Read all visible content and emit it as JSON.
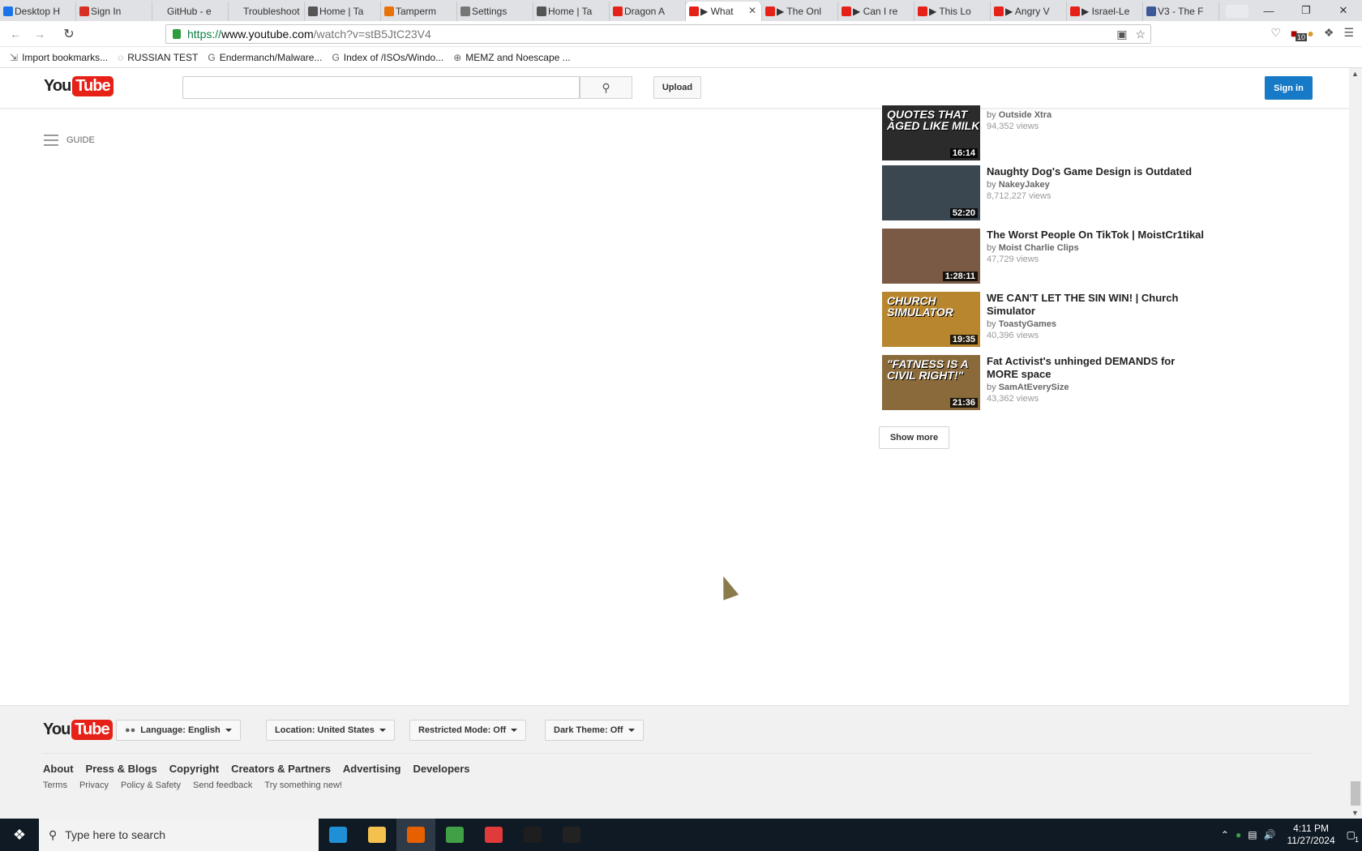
{
  "browser": {
    "tabs": [
      {
        "label": "Desktop H",
        "color": "#1a73e8"
      },
      {
        "label": "Sign In",
        "color": "#d93025"
      },
      {
        "label": "GitHub - e",
        "color": "#dfe1e5"
      },
      {
        "label": "Troubleshoot",
        "color": "#dfe1e5"
      },
      {
        "label": "Home | Ta",
        "color": "#555555"
      },
      {
        "label": "Tamperm",
        "color": "#e8710a"
      },
      {
        "label": "Settings",
        "color": "#777777"
      },
      {
        "label": "Home | Ta",
        "color": "#555555"
      },
      {
        "label": "Dragon A",
        "color": "#e62117"
      },
      {
        "label": "▶ What",
        "color": "#e62117",
        "active": true
      },
      {
        "label": "▶ The Onl",
        "color": "#e62117"
      },
      {
        "label": "▶ Can I re",
        "color": "#e62117"
      },
      {
        "label": "▶ This Lo",
        "color": "#e62117"
      },
      {
        "label": "▶ Angry V",
        "color": "#e62117"
      },
      {
        "label": "▶ Israel-Le",
        "color": "#e62117"
      },
      {
        "label": "V3 - The F",
        "color": "#3b5998"
      }
    ],
    "window_controls": {
      "minimize": "—",
      "maximize": "❐",
      "close": "✕"
    },
    "url": {
      "scheme": "https://",
      "host": "www.youtube.com",
      "path": "/watch?v=stB5JtC23V4"
    },
    "extension_badge": "10",
    "bookmarks": [
      {
        "label": "Import bookmarks...",
        "icon": "import-icon"
      },
      {
        "label": "RUSSIAN TEST",
        "icon": "blank-page-icon"
      },
      {
        "label": "Endermanch/Malware...",
        "icon": "google-icon"
      },
      {
        "label": "Index of /ISOs/Windo...",
        "icon": "google-icon"
      },
      {
        "label": "MEMZ and Noescape ...",
        "icon": "globe-icon"
      }
    ]
  },
  "youtube": {
    "logo": {
      "you": "You",
      "tube": "Tube"
    },
    "search_placeholder": "",
    "upload_label": "Upload",
    "signin_label": "Sign in",
    "guide_label": "GUIDE",
    "related": [
      {
        "title": "",
        "channel": "Outside Xtra",
        "views": "94,352 views",
        "duration": "16:14",
        "thumb_text": "QUOTES THAT AGED LIKE MILK",
        "thumb_color": "#2b2b2b"
      },
      {
        "title": "Naughty Dog's Game Design is Outdated",
        "channel": "NakeyJakey",
        "views": "8,712,227 views",
        "duration": "52:20",
        "thumb_text": "",
        "thumb_color": "#3a4650"
      },
      {
        "title": "The Worst People On TikTok | MoistCr1tikal",
        "channel": "Moist Charlie Clips",
        "views": "47,729 views",
        "duration": "1:28:11",
        "thumb_text": "",
        "thumb_color": "#7a5a44"
      },
      {
        "title": "WE CAN'T LET THE SIN WIN! | Church Simulator",
        "channel": "ToastyGames",
        "views": "40,396 views",
        "duration": "19:35",
        "thumb_text": "CHURCH SIMULATOR",
        "thumb_color": "#b8862e"
      },
      {
        "title": "Fat Activist's unhinged DEMANDS for MORE space",
        "channel": "SamAtEverySize",
        "views": "43,362 views",
        "duration": "21:36",
        "thumb_text": "\"FATNESS IS A CIVIL RIGHT!\"",
        "thumb_color": "#8a6a3a"
      }
    ],
    "by_prefix": "by",
    "show_more_label": "Show more",
    "footer": {
      "language": "Language: English",
      "location": "Location: United States",
      "restricted": "Restricted Mode: Off",
      "dark_theme": "Dark Theme: Off",
      "primary_links": [
        "About",
        "Press & Blogs",
        "Copyright",
        "Creators & Partners",
        "Advertising",
        "Developers"
      ],
      "secondary_links": [
        "Terms",
        "Privacy",
        "Policy & Safety",
        "Send feedback",
        "Try something new!"
      ]
    }
  },
  "taskbar": {
    "search_placeholder": "Type here to search",
    "apps": [
      {
        "name": "edge",
        "color": "#1f8fd6"
      },
      {
        "name": "file-explorer",
        "color": "#f2c14e"
      },
      {
        "name": "firefox",
        "color": "#e66000",
        "active": true
      },
      {
        "name": "green-app",
        "color": "#3fa046"
      },
      {
        "name": "red-app",
        "color": "#e03a3a"
      },
      {
        "name": "terminal",
        "color": "#1e1e1e"
      },
      {
        "name": "7zip",
        "color": "#222222"
      }
    ],
    "time": "4:11 PM",
    "date": "11/27/2024",
    "notification_count": "1"
  }
}
